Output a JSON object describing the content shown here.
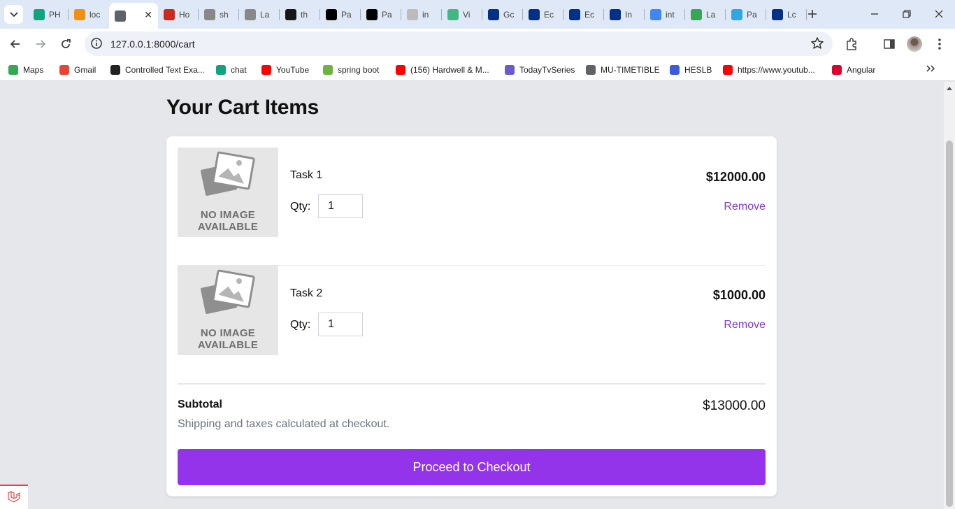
{
  "browser": {
    "tabs": [
      {
        "label": "PH",
        "icon": "chatgpt-icon",
        "color": "#10a37f"
      },
      {
        "label": "loc",
        "icon": "phpmyadmin-icon",
        "color": "#f29111"
      },
      {
        "label": "",
        "icon": "globe-icon",
        "color": "#5f6368",
        "active": true
      },
      {
        "label": "Ho",
        "icon": "hostinger-icon",
        "color": "#cc2a1f"
      },
      {
        "label": "sh",
        "icon": "google-icon",
        "color": "#888888"
      },
      {
        "label": "La",
        "icon": "google-icon",
        "color": "#888888"
      },
      {
        "label": "th",
        "icon": "github-icon",
        "color": "#181717"
      },
      {
        "label": "Pa",
        "icon": "dev-icon",
        "color": "#000000"
      },
      {
        "label": "Pa",
        "icon": "medium-icon",
        "color": "#000000"
      },
      {
        "label": "in",
        "icon": "loading-icon",
        "color": "#bbbbbb"
      },
      {
        "label": "Vi",
        "icon": "vue-icon",
        "color": "#41b883"
      },
      {
        "label": "Gc",
        "icon": "paypal-icon",
        "color": "#003087"
      },
      {
        "label": "Ec",
        "icon": "paypal-icon",
        "color": "#003087"
      },
      {
        "label": "Ec",
        "icon": "paypal-icon",
        "color": "#003087"
      },
      {
        "label": "In",
        "icon": "paypal-icon",
        "color": "#003087"
      },
      {
        "label": "int",
        "icon": "google-icon",
        "color": "#4285f4"
      },
      {
        "label": "La",
        "icon": "greenbox-icon",
        "color": "#34a853"
      },
      {
        "label": "Pa",
        "icon": "cube-icon",
        "color": "#2ea8e0"
      },
      {
        "label": "Lc",
        "icon": "paypal-icon",
        "color": "#003087"
      }
    ],
    "url": "127.0.0.1:8000/cart",
    "bookmarks": [
      {
        "label": "Maps",
        "icon": "maps-icon",
        "color": "#34a853"
      },
      {
        "label": "Gmail",
        "icon": "gmail-icon",
        "color": "#ea4335"
      },
      {
        "label": "Controlled Text Exa...",
        "icon": "codepen-icon",
        "color": "#222222"
      },
      {
        "label": "chat",
        "icon": "chatgpt-icon",
        "color": "#10a37f"
      },
      {
        "label": "YouTube",
        "icon": "youtube-icon",
        "color": "#ff0000"
      },
      {
        "label": "spring boot",
        "icon": "spring-icon",
        "color": "#6db33f"
      },
      {
        "label": "(156) Hardwell & M...",
        "icon": "youtube-icon",
        "color": "#ff0000"
      },
      {
        "label": "TodayTvSeries",
        "icon": "film-icon",
        "color": "#6a5acd"
      },
      {
        "label": "MU-TIMETIBLE",
        "icon": "globe-icon",
        "color": "#5f6368"
      },
      {
        "label": "HESLB",
        "icon": "heslb-icon",
        "color": "#3b5bdb"
      },
      {
        "label": "https://www.youtub...",
        "icon": "youtube-icon",
        "color": "#ff0000"
      },
      {
        "label": "Angular",
        "icon": "angular-icon",
        "color": "#dd0031"
      }
    ]
  },
  "page": {
    "title": "Your Cart Items",
    "image_placeholder": "NO IMAGE AVAILABLE",
    "qty_label": "Qty:",
    "remove_label": "Remove",
    "items": [
      {
        "name": "Task 1",
        "quantity": "1",
        "price": "$12000.00"
      },
      {
        "name": "Task 2",
        "quantity": "1",
        "price": "$1000.00"
      }
    ],
    "subtotal_label": "Subtotal",
    "subtotal_value": "$13000.00",
    "shipping_note": "Shipping and taxes calculated at checkout.",
    "checkout_label": "Proceed to Checkout"
  },
  "colors": {
    "accent": "#9333ea",
    "remove_link": "#7e3ad9",
    "page_bg": "#e5e7eb"
  }
}
